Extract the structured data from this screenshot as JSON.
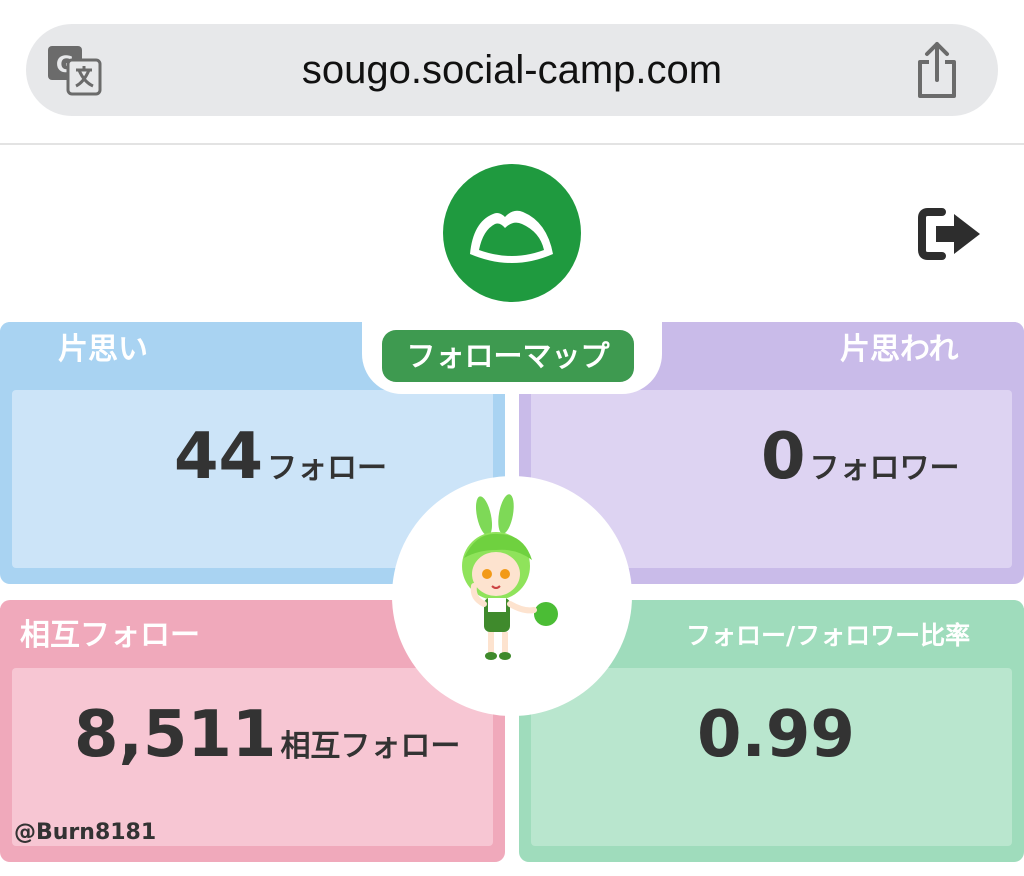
{
  "browser": {
    "url": "sougo.social-camp.com",
    "translate_icon": "translate-icon",
    "share_icon": "share-icon"
  },
  "header": {
    "logo_icon": "mountain-logo-icon",
    "logout_icon": "logout-icon"
  },
  "center": {
    "title": "フォローマップ",
    "mascot": "green-character-illustration"
  },
  "cards": {
    "one_sided_love": {
      "label": "片思い",
      "value": "44",
      "unit": "フォロー"
    },
    "one_sided_loved": {
      "label": "片思われ",
      "value": "0",
      "unit": "フォロワー"
    },
    "mutual": {
      "label": "相互フォロー",
      "value": "8,511",
      "unit": "相互フォロー"
    },
    "ratio": {
      "label": "フォロー/フォロワー比率",
      "value": "0.99"
    }
  },
  "credit": "@Burn8181",
  "colors": {
    "blue": "#a9d3f2",
    "purple": "#c9bbe9",
    "pink": "#f0a9bb",
    "green": "#9fdcbc",
    "brand_green": "#1f9a3f"
  }
}
